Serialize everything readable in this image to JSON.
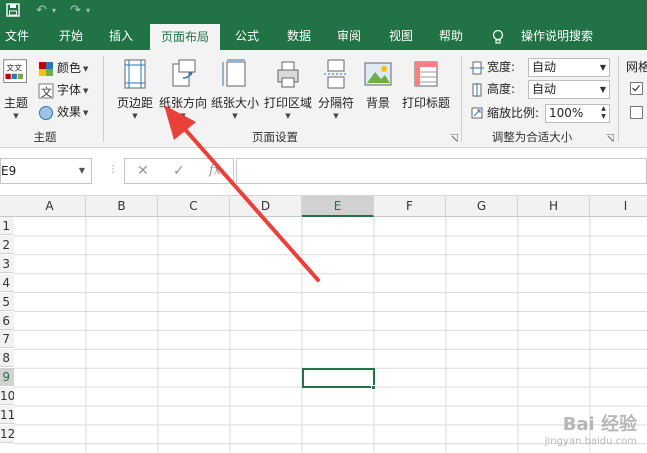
{
  "tabs": [
    "文件",
    "开始",
    "插入",
    "页面布局",
    "公式",
    "数据",
    "审阅",
    "视图",
    "帮助"
  ],
  "active_tab": "页面布局",
  "tell_me": "操作说明搜索",
  "theme_group": {
    "themes_label": "主题",
    "colors_label": "颜色",
    "fonts_label": "字体",
    "effects_label": "效果",
    "group_label": "主题"
  },
  "page_setup": {
    "margins": "页边距",
    "orientation": "纸张方向",
    "size": "纸张大小",
    "print_area": "打印区域",
    "breaks": "分隔符",
    "background": "背景",
    "print_titles": "打印标题",
    "group_label": "页面设置"
  },
  "scale_to_fit": {
    "width_label": "宽度:",
    "width_value": "自动",
    "height_label": "高度:",
    "height_value": "自动",
    "scale_label": "缩放比例:",
    "scale_value": "100%",
    "group_label": "调整为合适大小"
  },
  "sheet_options": {
    "gridlines_label": "网格"
  },
  "formula_bar": {
    "name_box": "E9",
    "fx": "fx"
  },
  "columns": [
    "A",
    "B",
    "C",
    "D",
    "E",
    "F",
    "G",
    "H",
    "I"
  ],
  "selected_column": "E",
  "rows": [
    "1",
    "2",
    "3",
    "4",
    "5",
    "6",
    "7",
    "8",
    "9",
    "10",
    "11",
    "12"
  ],
  "selected_row": "9",
  "watermark": {
    "line1": "Bai 经验",
    "line2": "jingyan.baidu.com"
  },
  "colors": {
    "accent": "#217346",
    "arrow": "#e8413a"
  }
}
